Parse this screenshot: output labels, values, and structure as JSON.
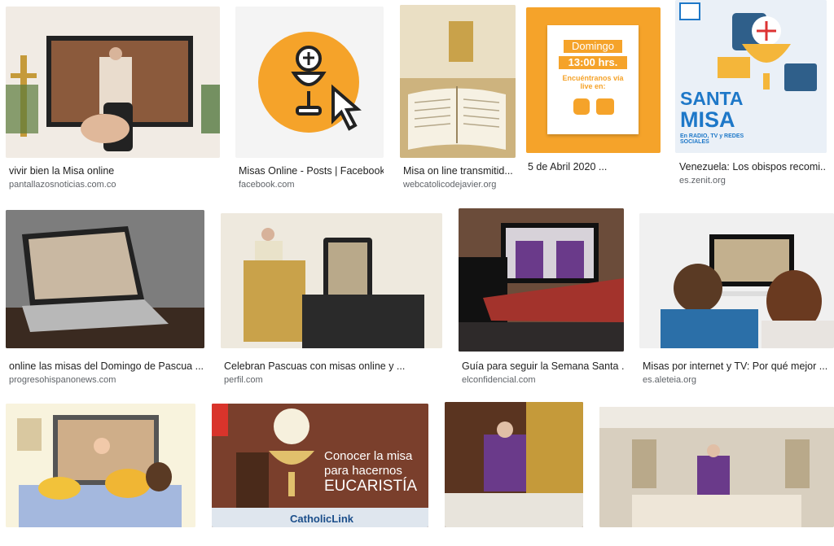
{
  "results": [
    {
      "title": "vivir bien la Misa online",
      "source": "pantallazosnoticias.com.co"
    },
    {
      "title": "Misas Online - Posts | Facebook",
      "source": "facebook.com"
    },
    {
      "title": "Misa on line transmitid...",
      "source": "webcatolicodejavier.org"
    },
    {
      "title": "5 de Abril 2020 ...",
      "source": ""
    },
    {
      "title": "Venezuela: Los obispos recomi...",
      "source": "es.zenit.org"
    },
    {
      "title": "online las misas del Domingo de Pascua ...",
      "source": "progresohispanonews.com"
    },
    {
      "title": "Celebran Pascuas con misas online y ...",
      "source": "perfil.com"
    },
    {
      "title": "Guía para seguir la Semana Santa ...",
      "source": "elconfidencial.com"
    },
    {
      "title": "Misas por internet y TV: Por qué mejor ...",
      "source": "es.aleteia.org"
    }
  ],
  "thumb_text": {
    "domingo": "Domingo",
    "time": "13:00 hrs.",
    "encuentranos": "Encuéntranos vía live en:",
    "santa": "SANTA",
    "misa": "MISA",
    "redes": "En RADIO, TV y REDES SOCIALES",
    "conocer": "Conocer la misa para hacernos",
    "eucaristia": "EUCARISTÍA",
    "catholiclink": "CatholicLink"
  },
  "colors": {
    "accent": "#f5a32a",
    "text": "#222222",
    "source": "#5f6368"
  }
}
